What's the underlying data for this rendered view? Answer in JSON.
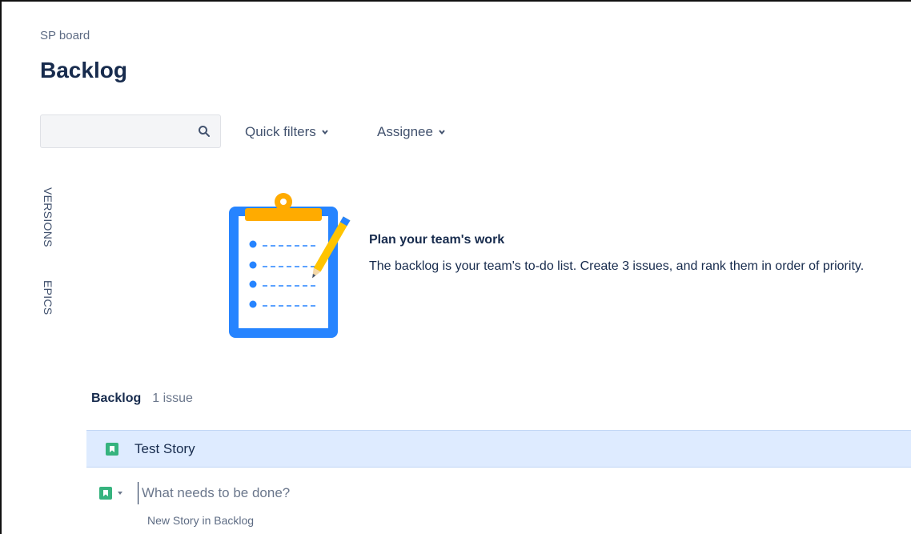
{
  "breadcrumb": "SP board",
  "page_title": "Backlog",
  "search": {
    "value": "",
    "placeholder": ""
  },
  "filters": {
    "quick_filters": "Quick filters",
    "assignee": "Assignee"
  },
  "side_tabs": {
    "versions": "VERSIONS",
    "epics": "EPICS"
  },
  "empty_state": {
    "title": "Plan your team's work",
    "description": "The backlog is your team's to-do list. Create 3 issues, and rank them in order of priority."
  },
  "backlog": {
    "label": "Backlog",
    "count": "1 issue",
    "issues": [
      {
        "summary": "Test Story",
        "type_icon": "story-icon"
      }
    ]
  },
  "create": {
    "placeholder": "What needs to be done?",
    "hint": "New Story in Backlog"
  },
  "colors": {
    "story_green": "#36b37e",
    "selected_row": "#deebff",
    "clipboard_blue": "#2684ff",
    "clip_orange": "#ffab00"
  }
}
